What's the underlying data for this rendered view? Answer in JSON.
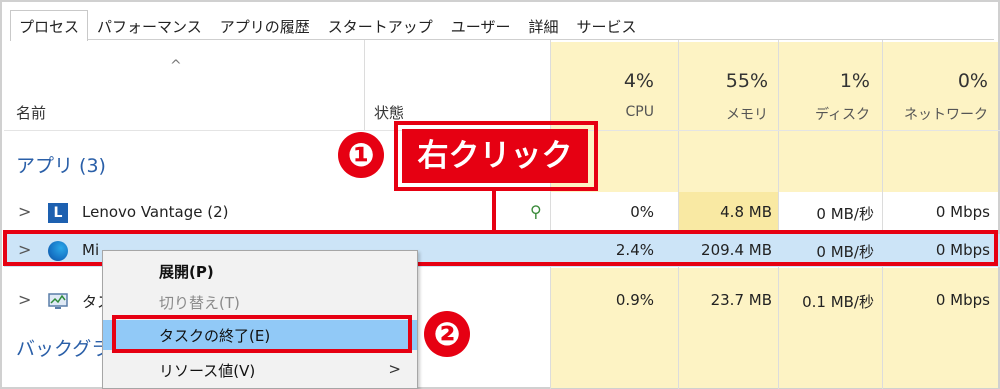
{
  "tabs": [
    "プロセス",
    "パフォーマンス",
    "アプリの履歴",
    "スタートアップ",
    "ユーザー",
    "詳細",
    "サービス"
  ],
  "header": {
    "sort_caret": "^",
    "name": "名前",
    "status": "状態",
    "cpu_pct": "4%",
    "cpu_label": "CPU",
    "mem_pct": "55%",
    "mem_label": "メモリ",
    "disk_pct": "1%",
    "disk_label": "ディスク",
    "net_pct": "0%",
    "net_label": "ネットワーク"
  },
  "groups": {
    "apps": "アプリ (3)",
    "background": "バックグラ"
  },
  "rows": [
    {
      "chevron": ">",
      "name": "Lenovo Vantage (2)",
      "icon": "lenovo-icon",
      "icon_text": "L",
      "cpu": "0%",
      "mem": "4.8 MB",
      "disk": "0 MB/秒",
      "net": "0 Mbps"
    },
    {
      "chevron": ">",
      "name": "Mi",
      "icon": "edge-icon",
      "cpu": "2.4%",
      "mem": "209.4 MB",
      "disk": "0 MB/秒",
      "net": "0 Mbps"
    },
    {
      "chevron": ">",
      "name": "タス",
      "icon": "task-manager-icon",
      "cpu": "0.9%",
      "mem": "23.7 MB",
      "disk": "0.1 MB/秒",
      "net": "0 Mbps"
    }
  ],
  "status_icon": "leaf-icon",
  "callout": {
    "step1_number": "❶",
    "step1_text": "右クリック",
    "step2_number": "❷"
  },
  "context_menu": {
    "expand": "展開(P)",
    "switch_to": "切り替え(T)",
    "end_task": "タスクの終了(E)",
    "resource_values": "リソース値(V)",
    "submenu_arrow": ">"
  },
  "colors": {
    "highlight_red": "#e60012",
    "selected_row": "#cce4f7",
    "heat_yellow": "#fdf3c4",
    "menu_hover": "#91c9f7"
  }
}
